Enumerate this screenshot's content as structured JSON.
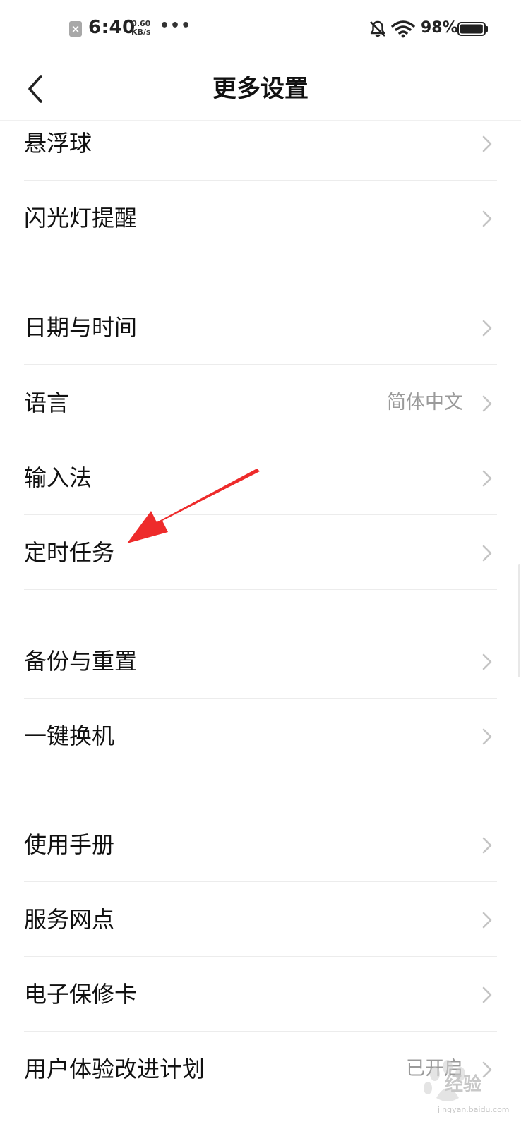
{
  "status_bar": {
    "time": "6:40",
    "net_speed_value": "0.60",
    "net_speed_unit": "KB/s",
    "overflow_dots": "•••",
    "notification_icon": "x-badge-icon",
    "mute_icon": "bell-muted-icon",
    "wifi_icon": "wifi-icon",
    "battery_text": "98%",
    "battery_level": 0.98
  },
  "header": {
    "title": "更多设置",
    "back_icon": "chevron-left-icon"
  },
  "settings": {
    "items": [
      {
        "label": "悬浮球",
        "value": ""
      },
      {
        "label": "闪光灯提醒",
        "value": ""
      },
      {
        "label": "日期与时间",
        "value": ""
      },
      {
        "label": "语言",
        "value": "简体中文"
      },
      {
        "label": "输入法",
        "value": ""
      },
      {
        "label": "定时任务",
        "value": ""
      },
      {
        "label": "备份与重置",
        "value": ""
      },
      {
        "label": "一键换机",
        "value": ""
      },
      {
        "label": "使用手册",
        "value": ""
      },
      {
        "label": "服务网点",
        "value": ""
      },
      {
        "label": "电子保修卡",
        "value": ""
      },
      {
        "label": "用户体验改进计划",
        "value": "已开启"
      }
    ]
  },
  "annotation": {
    "arrow_color": "#ee2b2b"
  },
  "watermark": {
    "text": "经验",
    "sub": "jingyan.baidu.com"
  }
}
